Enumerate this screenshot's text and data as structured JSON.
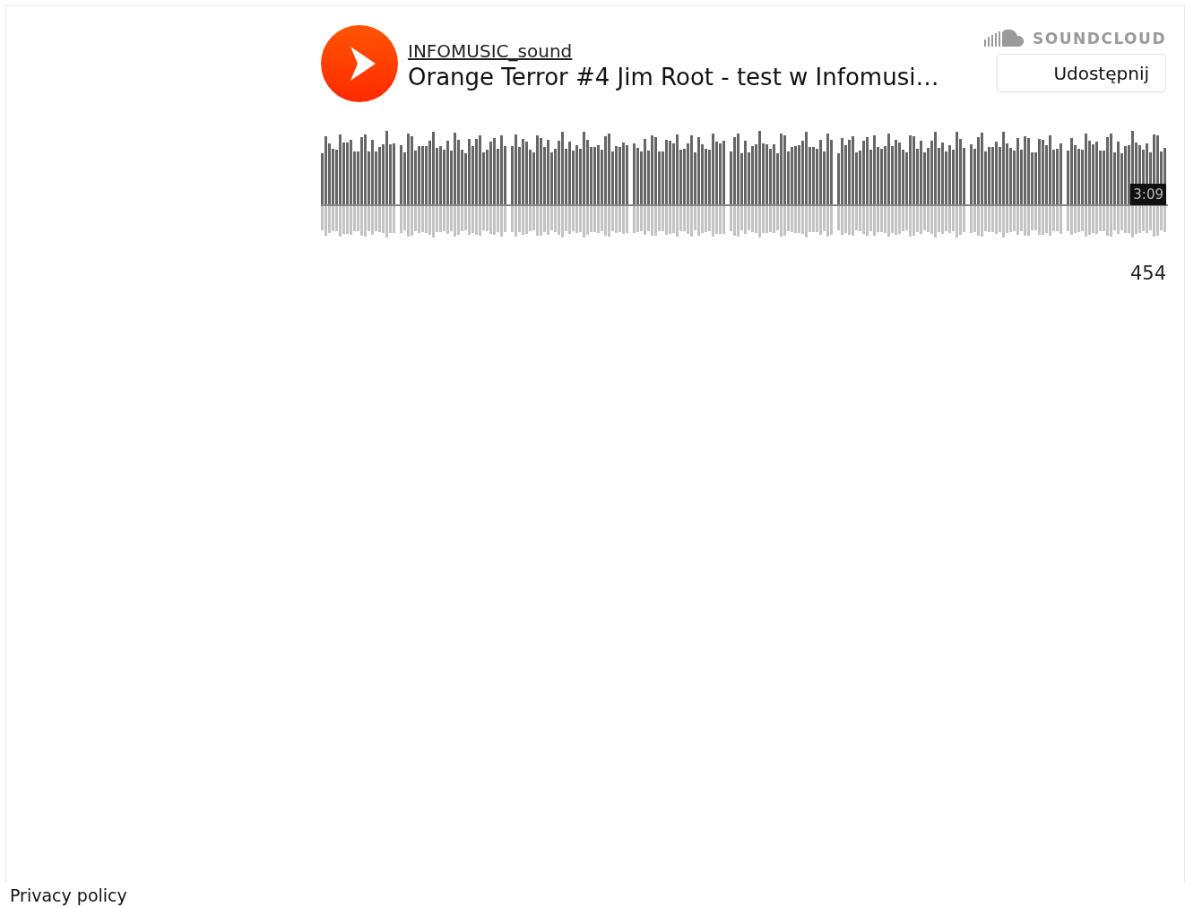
{
  "player": {
    "artist": "INFOMUSIC_sound",
    "title": "Orange Terror #4 Jim Root - test w Infomusi…",
    "brand": "SOUNDCLOUD",
    "share_button": "Udostępnij",
    "duration": "3:09",
    "play_count": "454"
  },
  "footer": {
    "link": "Privacy policy"
  }
}
